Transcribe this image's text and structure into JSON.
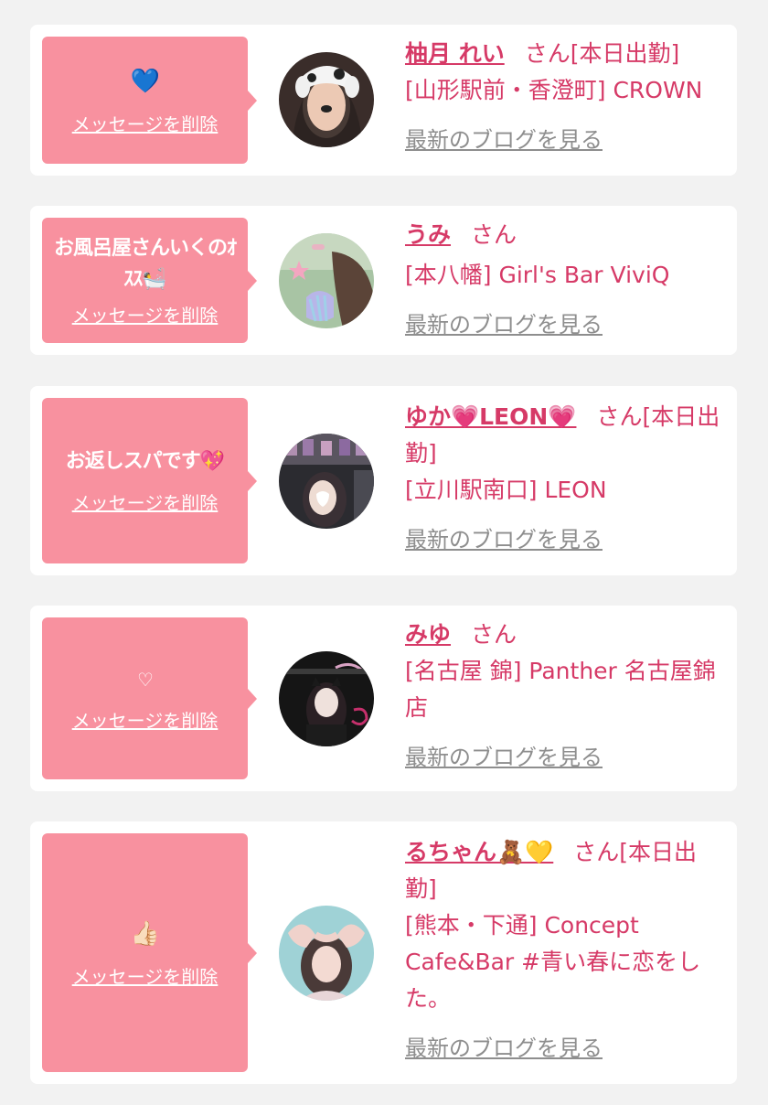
{
  "posts": [
    {
      "message": "💙",
      "delete_label": "メッセージを削除",
      "name": "柚月 れい",
      "honorific": "さん[本日出勤]",
      "shop": "[山形駅前・香澄町] CROWN",
      "blog_label": "最新のブログを見る"
    },
    {
      "message": "お風呂屋さんいくのｵｽｽ🛀",
      "delete_label": "メッセージを削除",
      "name": "うみ",
      "honorific": "さん",
      "shop": "[本八幡] Girl's Bar ViviQ",
      "blog_label": "最新のブログを見る"
    },
    {
      "message": "お返しスパです💖",
      "delete_label": "メッセージを削除",
      "name": "ゆか💗LEON💗",
      "honorific": "さん[本日出勤]",
      "shop": "[立川駅南口] LEON",
      "blog_label": "最新のブログを見る"
    },
    {
      "message": "♡",
      "delete_label": "メッセージを削除",
      "name": "みゆ",
      "honorific": "さん",
      "shop": "[名古屋 錦] Panther 名古屋錦店",
      "blog_label": "最新のブログを見る"
    },
    {
      "message": "👍🏻",
      "delete_label": "メッセージを削除",
      "name": "るちゃん🧸💛",
      "honorific": "さん[本日出勤]",
      "shop": "[熊本・下通] Concept Cafe&Bar #青い春に恋をした。",
      "blog_label": "最新のブログを見る"
    }
  ]
}
